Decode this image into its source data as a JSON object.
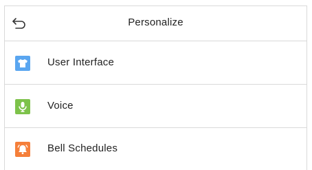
{
  "header": {
    "title": "Personalize",
    "back_icon": "back-arrow-icon"
  },
  "menu": {
    "items": [
      {
        "label": "User Interface",
        "icon": "tshirt-icon",
        "color": "#5aa6f0"
      },
      {
        "label": "Voice",
        "icon": "microphone-icon",
        "color": "#7dc24a"
      },
      {
        "label": "Bell Schedules",
        "icon": "bell-icon",
        "color": "#f57f3a"
      }
    ]
  },
  "colors": {
    "divider": "#d9d9d9",
    "background": "#ffffff",
    "text": "#222222"
  }
}
